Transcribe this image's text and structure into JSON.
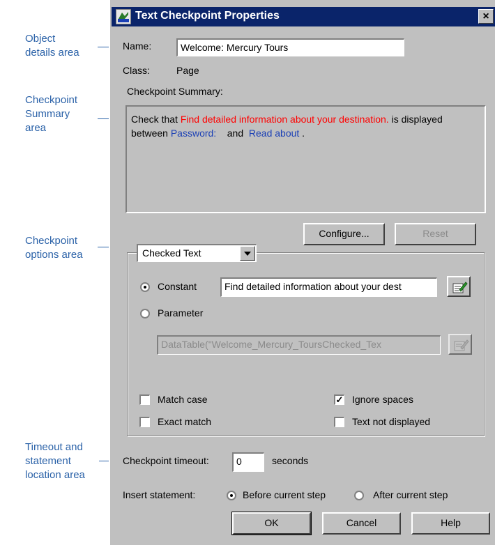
{
  "annotations": {
    "object_details": "Object\ndetails area",
    "checkpoint_summary": "Checkpoint\nSummary\narea",
    "checkpoint_options": "Checkpoint\noptions  area",
    "timeout_location": "Timeout and\nstatement\nlocation area"
  },
  "dialog": {
    "title": "Text Checkpoint Properties",
    "close_label": "×"
  },
  "object_details": {
    "name_label": "Name:",
    "name_value": "Welcome: Mercury Tours",
    "class_label": "Class:",
    "class_value": "Page",
    "summary_label": "Checkpoint Summary:"
  },
  "summary": {
    "part1": "Check that ",
    "checked_text": "Find detailed information about your destination.",
    "part2": " is displayed between ",
    "before_text": "Password:",
    "part3": "    and  ",
    "after_text": "Read about",
    "part4": " ."
  },
  "buttons": {
    "configure": "Configure...",
    "reset": "Reset",
    "ok": "OK",
    "cancel": "Cancel",
    "help": "Help"
  },
  "options": {
    "dropdown_selected": "Checked Text",
    "constant_label": "Constant",
    "constant_value": "Find detailed information about your dest",
    "parameter_label": "Parameter",
    "parameter_value": "DataTable(\"Welcome_Mercury_ToursChecked_Tex",
    "selected_source": "constant",
    "match_case_label": "Match case",
    "match_case": false,
    "ignore_spaces_label": "Ignore spaces",
    "ignore_spaces": true,
    "exact_match_label": "Exact match",
    "exact_match": false,
    "text_not_displayed_label": "Text not displayed",
    "text_not_displayed": false
  },
  "timeout": {
    "label": "Checkpoint timeout:",
    "value": "0",
    "unit": "seconds"
  },
  "insert": {
    "label": "Insert statement:",
    "before_label": "Before current step",
    "after_label": "After current step",
    "selected": "before"
  },
  "colors": {
    "titlebar": "#0a246a",
    "dialog_face": "#c0c0c0",
    "annotation": "#2b62a8",
    "checked_text": "#ff0000",
    "boundary_text": "#1a3fb5"
  }
}
